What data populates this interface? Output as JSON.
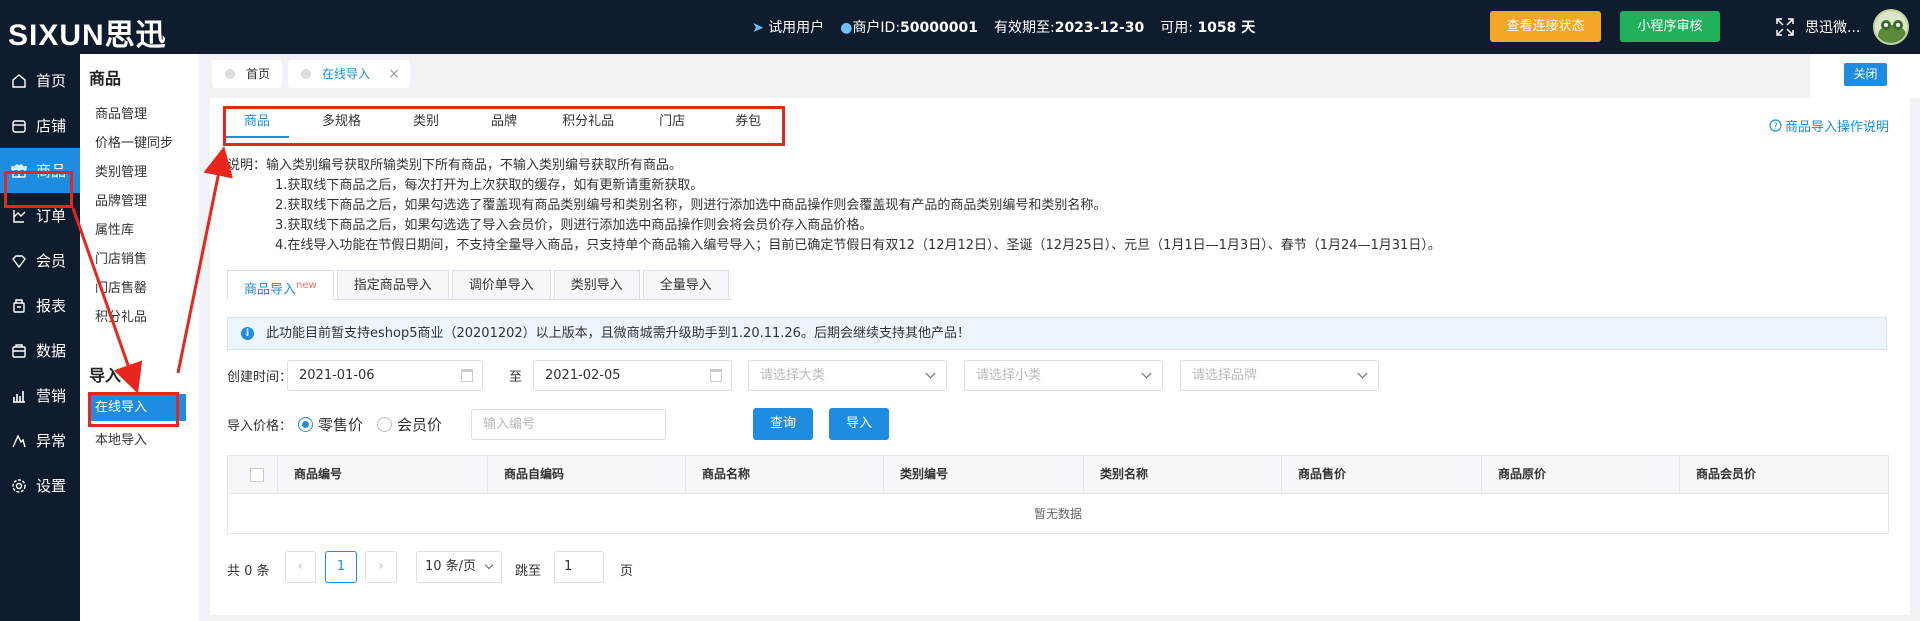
{
  "brand": {
    "logo": "SIXUN思迅"
  },
  "topbar": {
    "trial_user": "试用用户",
    "merchant_id_label": "商户ID:",
    "merchant_id": "50000001",
    "expiry_label": "有效期至:",
    "expiry": "2023-12-30",
    "available_label": "可用:",
    "available": "1058 天",
    "check_status_btn": "查看连接状态",
    "miniapp_btn": "小程序审核",
    "user_name": "思迅微...",
    "colors": {
      "background": "#0f1c2e",
      "orange": "#f5a623",
      "green": "#21b05b",
      "accent": "#1e8ce0",
      "annotation": "#e8261d"
    }
  },
  "sidebar": {
    "items": [
      {
        "label": "首页",
        "icon": "home-icon"
      },
      {
        "label": "店铺",
        "icon": "store-icon"
      },
      {
        "label": "商品",
        "icon": "gift-icon",
        "active": true
      },
      {
        "label": "订单",
        "icon": "order-icon"
      },
      {
        "label": "会员",
        "icon": "member-icon"
      },
      {
        "label": "报表",
        "icon": "report-icon"
      },
      {
        "label": "数据",
        "icon": "data-icon"
      },
      {
        "label": "营销",
        "icon": "marketing-icon"
      },
      {
        "label": "异常",
        "icon": "abnormal-icon"
      },
      {
        "label": "设置",
        "icon": "settings-icon"
      }
    ]
  },
  "submenu": {
    "goods_heading": "商品",
    "goods_items": [
      "商品管理",
      "价格一键同步",
      "类别管理",
      "品牌管理",
      "属性库",
      "门店销售",
      "门店售罄",
      "积分礼品"
    ],
    "import_heading": "导入",
    "import_items": [
      "在线导入",
      "本地导入"
    ]
  },
  "page_tabs": {
    "home": "首页",
    "current": "在线导入",
    "close_symbol": "×"
  },
  "close_button": "关闭",
  "category_tabs": [
    "商品",
    "多规格",
    "类别",
    "品牌",
    "积分礼品",
    "门店",
    "券包"
  ],
  "help_link": "商品导入操作说明",
  "description": [
    "说明：输入类别编号获取所输类别下所有商品，不输入类别编号获取所有商品。",
    "1.获取线下商品之后，每次打开为上次获取的缓存，如有更新请重新获取。",
    "2.获取线下商品之后，如果勾选选了覆盖现有商品类别编号和类别名称，则进行添加选中商品操作则会覆盖现有产品的商品类别编号和类别名称。",
    "3.获取线下商品之后，如果勾选选了导入会员价，则进行添加选中商品操作则会将会员价存入商品价格。",
    "4.在线导入功能在节假日期间，不支持全量导入商品，只支持单个商品输入编号导入；目前已确定节假日有双12（12月12日）、圣诞（12月25日）、元旦（1月1日—1月3日）、春节（1月24—1月31日）。"
  ],
  "import_tabs": {
    "items": [
      "商品导入",
      "指定商品导入",
      "调价单导入",
      "类别导入",
      "全量导入"
    ],
    "new_badge": "new"
  },
  "notice": "此功能目前暂支持eshop5商业（20201202）以上版本，且微商城需升级助手到1.20.11.26。后期会继续支持其他产品！",
  "filters": {
    "create_time_label": "创建时间：",
    "start_date": "2021-01-06",
    "to_label": "至",
    "end_date": "2021-02-05",
    "major_category_placeholder": "请选择大类",
    "minor_category_placeholder": "请选择小类",
    "brand_placeholder": "请选择品牌",
    "price_label": "导入价格：",
    "retail_price": "零售价",
    "member_price": "会员价",
    "code_placeholder": "输入编号",
    "query_btn": "查询",
    "import_btn": "导入"
  },
  "table": {
    "headers": [
      "商品编号",
      "商品自编码",
      "商品名称",
      "类别编号",
      "类别名称",
      "商品售价",
      "商品原价",
      "商品会员价"
    ],
    "empty_text": "暂无数据"
  },
  "pagination": {
    "total": "共 0 条",
    "current_page": "1",
    "page_size": "10 条/页",
    "jump_label": "跳至",
    "jump_value": "1",
    "page_suffix": "页"
  }
}
